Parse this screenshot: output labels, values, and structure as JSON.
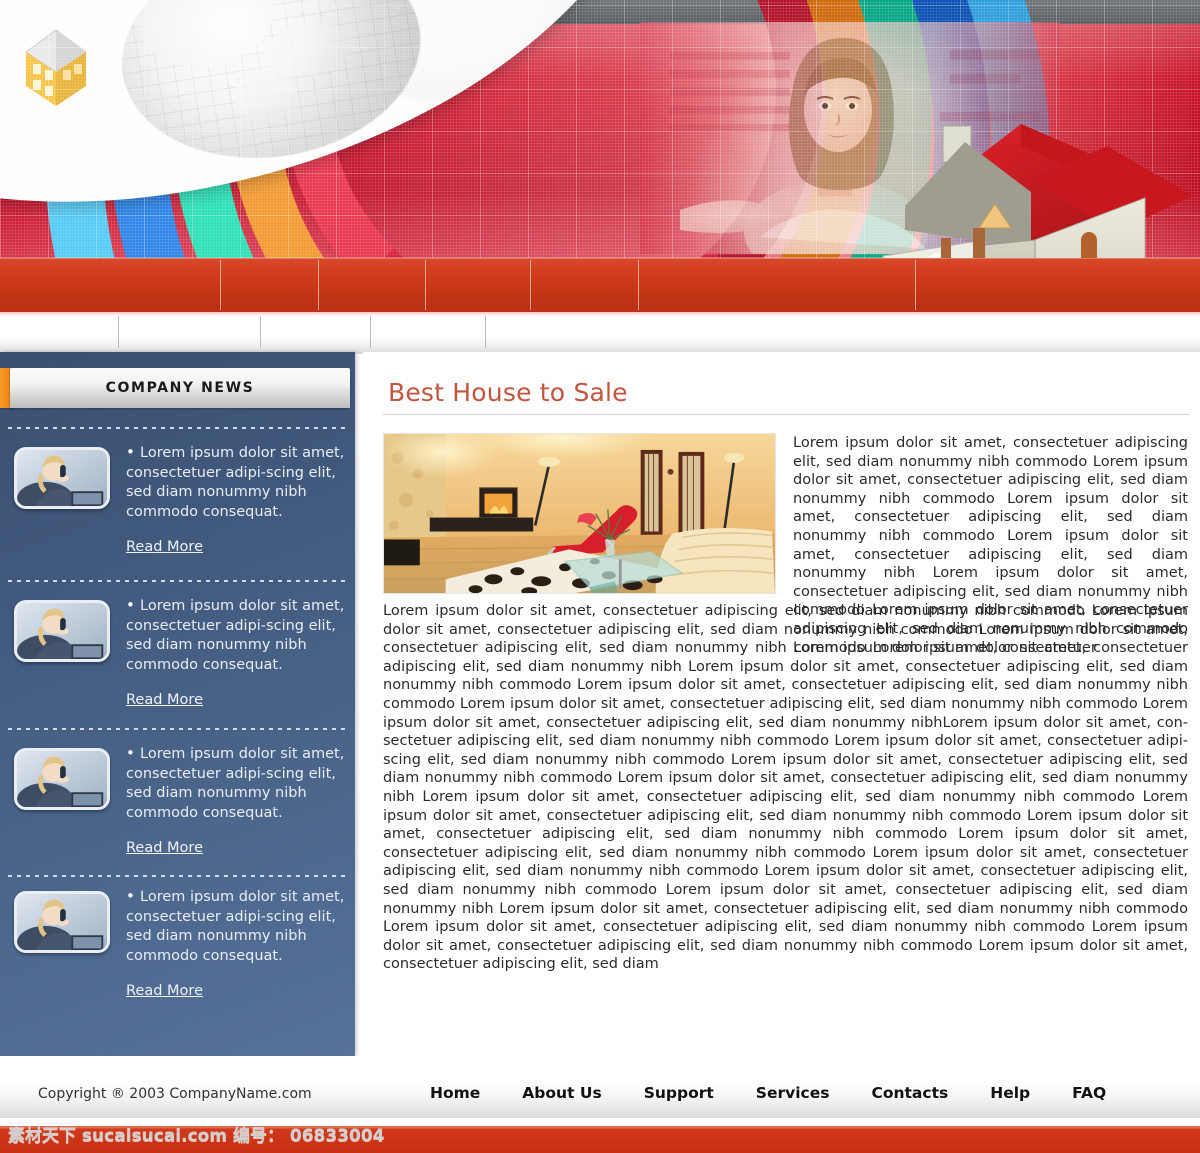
{
  "banner": {
    "logo_icon": "house-logo-icon",
    "globe_icon": "globe-icon",
    "photo_woman_alt": "woman-photo",
    "photo_house_alt": "red-roof-house-illustration",
    "arc_colors": [
      "#45c0f0",
      "#1668d6",
      "#12c9a0",
      "#e8821c",
      "#d81e3a"
    ]
  },
  "navbar": {
    "items": [
      {
        "label": ""
      },
      {
        "label": ""
      },
      {
        "label": ""
      },
      {
        "label": ""
      },
      {
        "label": ""
      }
    ]
  },
  "sidebar": {
    "title": "COMPANY NEWS",
    "accent_color": "#ef8a13",
    "panel_color": "#455f82",
    "items": [
      {
        "thumb_alt": "businesswoman-on-phone",
        "text": "Lorem ipsum dolor sit amet, consectetuer adipi-scing elit, sed diam nonummy nibh commodo consequat.",
        "link": "Read More"
      },
      {
        "thumb_alt": "businesswoman-on-phone",
        "text": "Lorem ipsum dolor sit amet, consectetuer adipi-scing elit, sed diam nonummy nibh commodo consequat.",
        "link": "Read More"
      },
      {
        "thumb_alt": "businesswoman-on-phone",
        "text": "Lorem ipsum dolor sit amet, consectetuer adipi-scing elit, sed diam nonummy nibh commodo consequat.",
        "link": "Read More"
      },
      {
        "thumb_alt": "businesswoman-on-phone",
        "text": "Lorem ipsum dolor sit amet, consectetuer adipi-scing elit, sed diam nonummy nibh commodo consequat.",
        "link": "Read More"
      }
    ]
  },
  "main": {
    "title": "Best House to Sale",
    "title_color": "#c3553e",
    "photo_alt": "living-room-interior-photo",
    "intro_paragraph": "Lorem ipsum dolor sit amet, consectetuer adipiscing elit, sed diam nonummy nibh commodo Lorem ipsum dolor sit amet, consectetuer adipiscing elit, sed diam nonummy nibh commodo Lorem ipsum dolor sit amet, consectetuer adipiscing elit, sed diam nonummy nibh commodo Lorem ipsum dolor sit amet, consectetuer adipiscing elit, sed diam nonummy nibh Lorem ipsum dolor sit amet, consectetuer adipiscing elit, sed diam nonummy nibh commodo Lorem ipsum dolor sit amet, consectetuer adipiscing elit, sed diam nonummy nibh commodo Lorem ipsum dolor sit amet, consectetuer",
    "body_paragraph": "Lorem ipsum dolor sit amet, consectetuer adipiscing elit, sed diam nonummy nibh commodo Lorem ipsum dolor sit amet, consectetuer adipiscing elit, sed diam nonummy nibh commodo Lorem ipsum dolor sit amet, consectetuer adipiscing elit, sed diam nonummy nibh commodo Lorem ipsum dolor sit amet, consectetuer adipiscing elit, sed diam nonummy nibh Lorem ipsum dolor sit amet, consectetuer adipiscing elit, sed diam nonummy nibh commodo Lorem ipsum dolor sit amet, consectetuer adipiscing elit, sed diam nonummy nibh commodo Lorem ipsum dolor sit amet, consectetuer adipiscing elit, sed diam nonummy nibh commodo Lorem ipsum dolor sit amet, consectetuer adipiscing elit, sed diam nonummy nibhLorem ipsum dolor sit amet, con-sectetuer adipiscing elit, sed diam nonummy nibh commodo Lorem ipsum dolor sit amet, consectetuer adipi-scing elit, sed diam nonummy nibh commodo Lorem ipsum dolor sit amet, consectetuer adipiscing elit, sed diam nonummy nibh commodo Lorem ipsum dolor sit amet, consectetuer adipiscing elit, sed diam nonummy nibh Lorem ipsum dolor sit amet, consectetuer adipiscing elit, sed diam nonummy nibh commodo Lorem ipsum dolor sit amet, consectetuer adipiscing elit, sed diam nonummy nibh commodo Lorem ipsum dolor sit amet, consectetuer adipiscing elit, sed diam nonummy nibh commodo Lorem ipsum dolor sit amet, consectetuer adipiscing elit, sed diam nonummy nibh commodo Lorem ipsum dolor sit amet, consectetuer adipiscing elit, sed diam nonummy nibh commodo Lorem ipsum dolor sit amet, consectetuer adipiscing elit, sed diam nonummy nibh commodo Lorem ipsum dolor sit amet, consectetuer adipiscing elit, sed diam nonummy nibh Lorem ipsum dolor sit amet, consectetuer adipiscing elit, sed diam nonummy nibh commodo Lorem ipsum dolor sit amet, consectetuer adipiscing elit, sed diam nonummy nibh commodo Lorem ipsum dolor sit amet, consectetuer adipiscing elit, sed diam nonummy nibh commodo Lorem ipsum dolor sit amet, consectetuer adipiscing elit, sed diam"
  },
  "footer": {
    "copyright": "Copyright ® 2003 CompanyName.com",
    "nav": [
      {
        "label": "Home"
      },
      {
        "label": "About Us"
      },
      {
        "label": "Support"
      },
      {
        "label": "Services"
      },
      {
        "label": "Contacts"
      },
      {
        "label": "Help"
      },
      {
        "label": "FAQ"
      }
    ],
    "accent_color": "#c72f12"
  },
  "watermark": {
    "text": "素材天下 sucaisucai.com 编号： 06833004"
  }
}
